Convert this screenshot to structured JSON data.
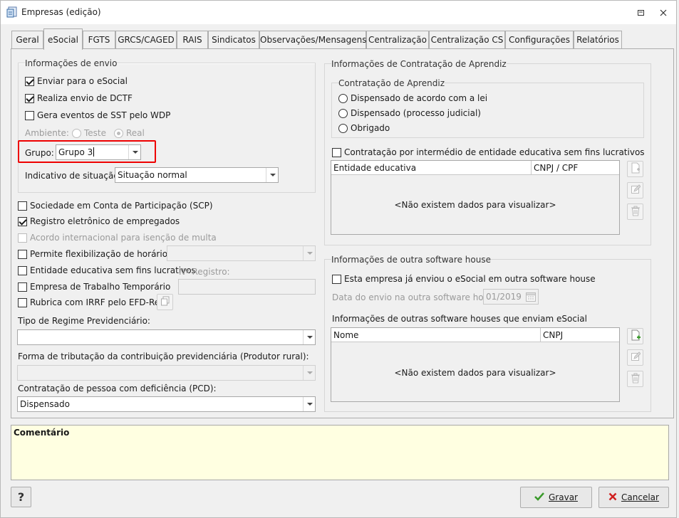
{
  "window": {
    "title": "Empresas (edição)"
  },
  "tabs": [
    "Geral",
    "eSocial",
    "FGTS",
    "GRCS/CAGED",
    "RAIS",
    "Sindicatos",
    "Observações/Mensagens",
    "Centralização",
    "Centralização CS",
    "Configurações",
    "Relatórios"
  ],
  "active_tab": "eSocial",
  "envio": {
    "title": "Informações de envio",
    "enviar": "Enviar para o eSocial",
    "dctf": "Realiza envio de DCTF",
    "sst": "Gera eventos de SST pelo WDP",
    "ambiente": "Ambiente:",
    "teste": "Teste",
    "real": "Real",
    "grupo_label": "Grupo:",
    "grupo_value": "Grupo 3",
    "indicativo_label": "Indicativo de situação:",
    "indicativo_value": "Situação normal"
  },
  "options": {
    "scp": "Sociedade em Conta de Participação (SCP)",
    "registro": "Registro eletrônico de empregados",
    "acordo": "Acordo internacional para isenção de multa",
    "flex": "Permite flexibilização de horários",
    "entidade": "Entidade educativa sem fins lucrativos",
    "nregistro": "Nº Registro:",
    "temporario": "Empresa de Trabalho Temporário",
    "rubrica": "Rubrica com IRRF pelo EFD-Reinf"
  },
  "regime": {
    "label": "Tipo de Regime Previdenciário:",
    "value": ""
  },
  "tributacao": {
    "label": "Forma de tributação da contribuição previdenciária (Produtor rural):",
    "value": ""
  },
  "pcd": {
    "label": "Contratação de pessoa com deficiência (PCD):",
    "value": "Dispensado"
  },
  "aprendiz": {
    "title": "Informações de Contratação de Aprendiz",
    "sub_title": "Contratação de Aprendiz",
    "opt1": "Dispensado de acordo com a lei",
    "opt2": "Dispensado (processo judicial)",
    "opt3": "Obrigado",
    "intermedio": "Contratação por intermédio de entidade educativa sem fins lucrativos",
    "col1": "Entidade educativa",
    "col2": "CNPJ / CPF",
    "empty": "<Não existem dados para visualizar>"
  },
  "software": {
    "title": "Informações de outra software house",
    "enviou": "Esta empresa já enviou o eSocial em outra software house",
    "data_label": "Data do envio na outra software house:",
    "data_value": "01/2019",
    "outras": "Informações de outras software houses que enviam eSocial",
    "col1": "Nome",
    "col2": "CNPJ",
    "empty": "<Não existem dados para visualizar>"
  },
  "comment": {
    "label": "Comentário"
  },
  "buttons": {
    "help": "?",
    "gravar": "Gravar",
    "cancelar": "Cancelar"
  },
  "colors": {
    "accent": "#e00000",
    "comment_bg": "#ffffe1",
    "ok_green": "#3a9a2b",
    "cancel_red": "#d02020"
  }
}
